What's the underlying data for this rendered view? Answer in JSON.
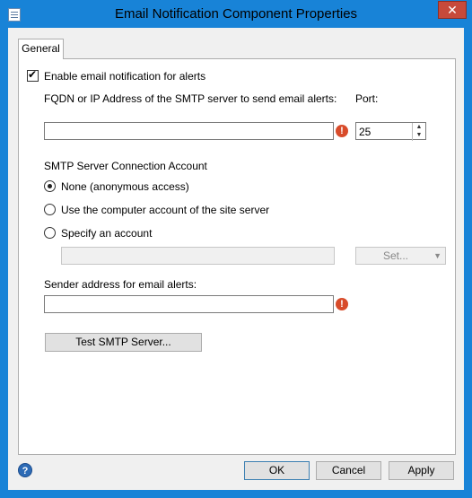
{
  "window": {
    "title": "Email Notification Component Properties",
    "close_glyph": "✕"
  },
  "tabs": [
    {
      "label": "General"
    }
  ],
  "general": {
    "enable_label": "Enable email notification for alerts",
    "enable_checked": true,
    "smtp_label": "FQDN or IP Address of the SMTP server to send email alerts:",
    "smtp_value": "",
    "port_label": "Port:",
    "port_value": "25",
    "account_heading": "SMTP Server Connection Account",
    "radio_none": "None (anonymous access)",
    "radio_computer": "Use the computer account of the site server",
    "radio_specify": "Specify an account",
    "selected_radio": "none",
    "account_value": "",
    "set_label": "Set...",
    "sender_label": "Sender address for email alerts:",
    "sender_value": "",
    "test_button": "Test SMTP Server..."
  },
  "footer": {
    "ok": "OK",
    "cancel": "Cancel",
    "apply": "Apply"
  },
  "icons": {
    "error": "!",
    "help": "?",
    "spin_up": "▲",
    "spin_down": "▼",
    "dropdown": "▼",
    "check": "✔"
  },
  "colors": {
    "titlebar": "#1883d7",
    "close": "#c74a3b",
    "error": "#d84b2a"
  }
}
